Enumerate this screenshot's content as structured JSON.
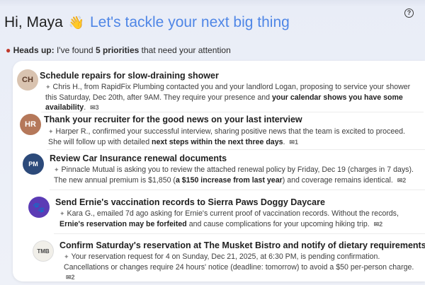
{
  "help_icon": "question-circle-icon",
  "greeting": {
    "hi": "Hi, Maya",
    "wave": "👋",
    "tagline": "Let's tackle your next big thing"
  },
  "headsup": {
    "icon": "warning-icon",
    "label": "Heads up:",
    "pre": " I've found ",
    "count": "5 priorities",
    "post": " that need your attention"
  },
  "priorities": [
    {
      "title": "Schedule repairs for slow-draining shower",
      "text_a": "Chris H., from RapidFix Plumbing contacted you and your landlord Logan, proposing to service your shower this Saturday, Dec 20th, after 9AM. They require your presence and ",
      "bold": "your calendar shows you have some availability",
      "text_b": ".",
      "thread": "3"
    },
    {
      "title": "Thank your recruiter for the good news on your last interview",
      "text_a": "Harper R., confirmed your successful interview, sharing positive news that the team is excited to proceed. She will follow up with detailed ",
      "bold": "next steps within the next three days",
      "text_b": ".",
      "thread": "1"
    },
    {
      "title": "Review Car Insurance renewal documents",
      "text_a": "Pinnacle Mutual is asking you to review the attached renewal policy by Friday, Dec 19 (charges in 7 days). The new annual premium is $1,850 (",
      "bold": "a $150 increase from last year",
      "text_b": ") and coverage remains identical.",
      "thread": "2"
    },
    {
      "title": "Send Ernie's vaccination records to Sierra Paws Doggy Daycare",
      "text_a": "Kara G., emailed 7d ago asking for Ernie's current proof of vaccination records. Without the records, ",
      "bold": "Ernie's reservation may be forfeited",
      "text_b": " and cause complications for your upcoming hiking trip.",
      "thread": "2"
    },
    {
      "title": "Confirm Saturday's reservation at The Musket Bistro and notify of dietary requirements",
      "text_a": "Your reservation request for 4 on Sunday, Dec 21, 2025, at 6:30 PM, is pending confirmation. Cancellations or changes require 24 hours' notice (deadline: tomorrow) to avoid a $50 per-person charge.",
      "bold": "",
      "text_b": "",
      "thread": "2"
    }
  ]
}
